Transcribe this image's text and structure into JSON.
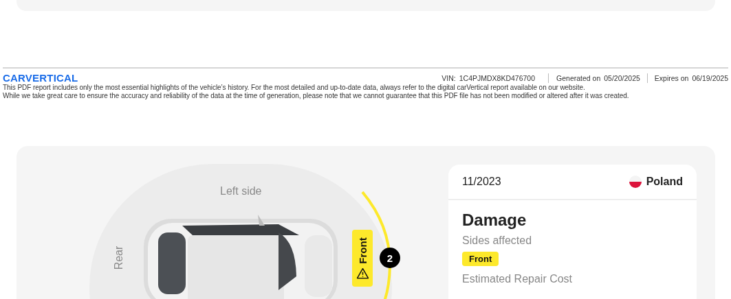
{
  "header": {
    "logo": "CARVERTICAL",
    "vin_label": "VIN:",
    "vin": "1C4PJMDX8KD476700",
    "generated_label": "Generated on",
    "generated": "05/20/2025",
    "expires_label": "Expires on",
    "expires": "06/19/2025"
  },
  "disclaimer": [
    "This PDF report includes only the most essential highlights of the vehicle’s history. For the most detailed and up-to-date data, always refer to the digital carVertical report available on our website.",
    "While we take great care to ensure the accuracy and reliability of the data at the time of generation, please note that we cannot guarantee that this PDF file has not been modified or altered after it was created."
  ],
  "diagram": {
    "top_label": "Left side",
    "rear_label": "Rear",
    "front_badge": "Front",
    "damage_count": "2"
  },
  "event": {
    "date": "11/2023",
    "country": "Poland",
    "title": "Damage",
    "sides_label": "Sides affected",
    "sides": [
      {
        "label": "Front"
      }
    ],
    "cost_label": "Estimated Repair Cost"
  }
}
